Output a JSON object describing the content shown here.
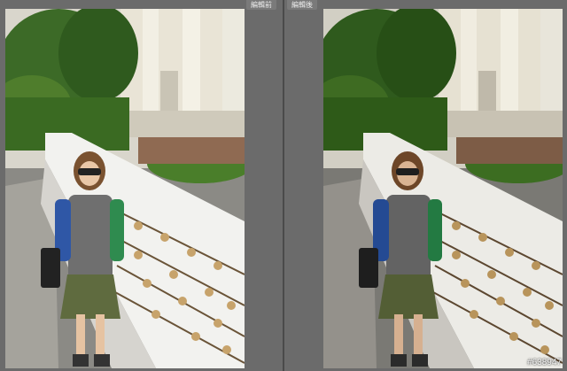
{
  "left_pane": {
    "label": "編輯前"
  },
  "right_pane": {
    "label": "編輯後"
  },
  "watermark": "#638947"
}
